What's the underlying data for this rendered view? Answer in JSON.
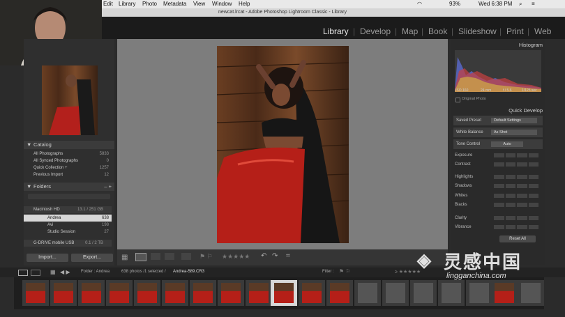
{
  "menubar": {
    "items": [
      "Edit",
      "Library",
      "Photo",
      "Metadata",
      "View",
      "Window",
      "Help"
    ],
    "battery": "93%",
    "clock": "Wed 6:38 PM"
  },
  "titlebar": {
    "text": "newcat.lrcat - Adobe Photoshop Lightroom Classic - Library"
  },
  "modules": [
    "Library",
    "Develop",
    "Map",
    "Book",
    "Slideshow",
    "Print",
    "Web"
  ],
  "left": {
    "catalog_title": "Catalog",
    "catalog_items": [
      {
        "label": "All Photographs",
        "count": "5833"
      },
      {
        "label": "All Synced Photographs",
        "count": "0"
      },
      {
        "label": "Quick Collection +",
        "count": "1257"
      },
      {
        "label": "Previous Import",
        "count": "12"
      }
    ],
    "folders_title": "Folders",
    "volume1": {
      "label": "Macintosh HD",
      "size": "13.1 / 251 GB"
    },
    "folders": [
      {
        "label": "Andrea",
        "count": "638"
      },
      {
        "label": "Avi",
        "count": "198"
      },
      {
        "label": "Studio Session",
        "count": "27"
      }
    ],
    "volume2": {
      "label": "G-DRIVE mobile USB",
      "size": "0.1 / 2 TB"
    },
    "import_label": "Import...",
    "export_label": "Export..."
  },
  "right": {
    "histogram_title": "Histogram",
    "histo_info": [
      "ISO 160",
      "24 mm",
      "f / 5.6",
      "1/125 sec"
    ],
    "original_photo": "Original Photo",
    "quick_develop_title": "Quick Develop",
    "saved_preset_label": "Saved Preset",
    "saved_preset_value": "Default Settings",
    "white_balance_label": "White Balance",
    "white_balance_value": "As Shot",
    "tone_control_label": "Tone Control",
    "auto_label": "Auto",
    "tone_rows": [
      "Exposure",
      "Contrast",
      "Highlights",
      "Shadows",
      "Whites",
      "Blacks",
      "Clarity",
      "Vibrance"
    ],
    "reset_label": "Reset All"
  },
  "filmstrip": {
    "source": "Folder : Andrea",
    "count": "638 photos /1 selected /",
    "filename": "Andrea-589.CR3",
    "filter_label": "Filter :"
  },
  "watermark": {
    "cn": "灵感中国",
    "url": "lingganchina.com"
  }
}
